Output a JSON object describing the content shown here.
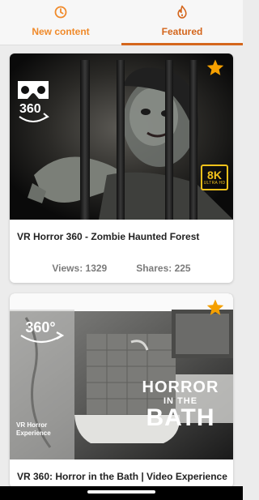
{
  "tabs": [
    {
      "label": "New content",
      "icon": "clock-icon",
      "active": false
    },
    {
      "label": "Featured",
      "icon": "flame-icon",
      "active": true
    }
  ],
  "colors": {
    "accent": "#d4661c",
    "accent_light": "#f08a2a",
    "star": "#f5a000"
  },
  "videos": [
    {
      "title": "VR Horror 360 - Zombie Haunted Forest",
      "views": "Views: 1329",
      "shares": "Shares: 225",
      "badge_360": "360",
      "badge_8k": "8K",
      "badge_8k_sub": "ULTRA HD",
      "featured_icon": "star-icon"
    },
    {
      "title": "VR 360: Horror in the Bath | Video Experience",
      "poster_360": "360°",
      "poster_line1": "HORROR",
      "poster_line2": "IN THE",
      "poster_line3": "BATH",
      "poster_caption_1": "VR Horror",
      "poster_caption_2": "Experience",
      "featured_icon": "star-icon"
    }
  ]
}
